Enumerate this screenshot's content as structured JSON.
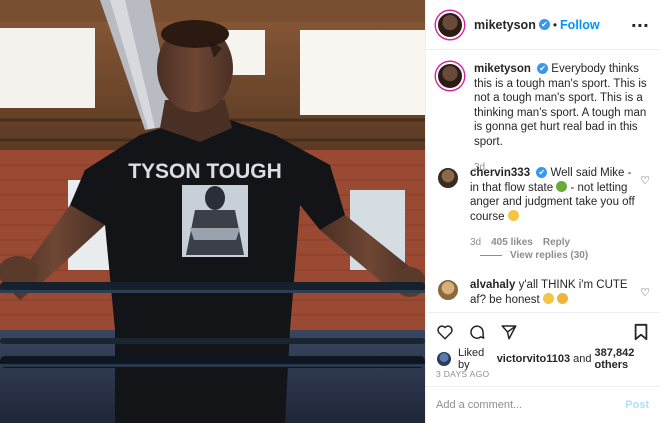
{
  "photo": {
    "shirt_text": "TYSON TOUGH"
  },
  "header": {
    "username": "miketyson",
    "verified_glyph": "✔",
    "separator": "•",
    "follow_label": "Follow",
    "more_glyph": "···"
  },
  "caption": {
    "username": "miketyson",
    "text": "Everybody thinks this is a tough man's sport. This is not a tough man's sport. This is a thinking man's sport. A tough man is gonna get hurt real bad in this sport.",
    "time": "3d"
  },
  "comments": [
    {
      "username": "chervin333",
      "text_before": "Well said Mike - in that flow state",
      "text_middle": "- not letting anger and judgment take you off course",
      "time": "3d",
      "likes": "405 likes",
      "reply_label": "Reply",
      "view_replies": "View replies (30)"
    },
    {
      "username": "alvahaly",
      "text": "y'all THINK i'm CUTE af? be honest"
    }
  ],
  "actions": {
    "liked_by_prefix": "Liked by",
    "liked_by_user": "victorvito1103",
    "liked_by_and": "and",
    "liked_by_count": "387,842 others",
    "posted_ago": "3 DAYS AGO"
  },
  "add_comment": {
    "placeholder": "Add a comment...",
    "post_label": "Post"
  },
  "icons": {
    "heart": "heart-icon",
    "comment": "comment-icon",
    "share": "share-icon",
    "save": "bookmark-icon",
    "more": "more-options-icon"
  },
  "colors": {
    "link_blue": "#0095f6",
    "post_disabled": "#b2dffc",
    "verified": "#3897f0",
    "muted": "#8e8e8e",
    "text": "#262626"
  }
}
